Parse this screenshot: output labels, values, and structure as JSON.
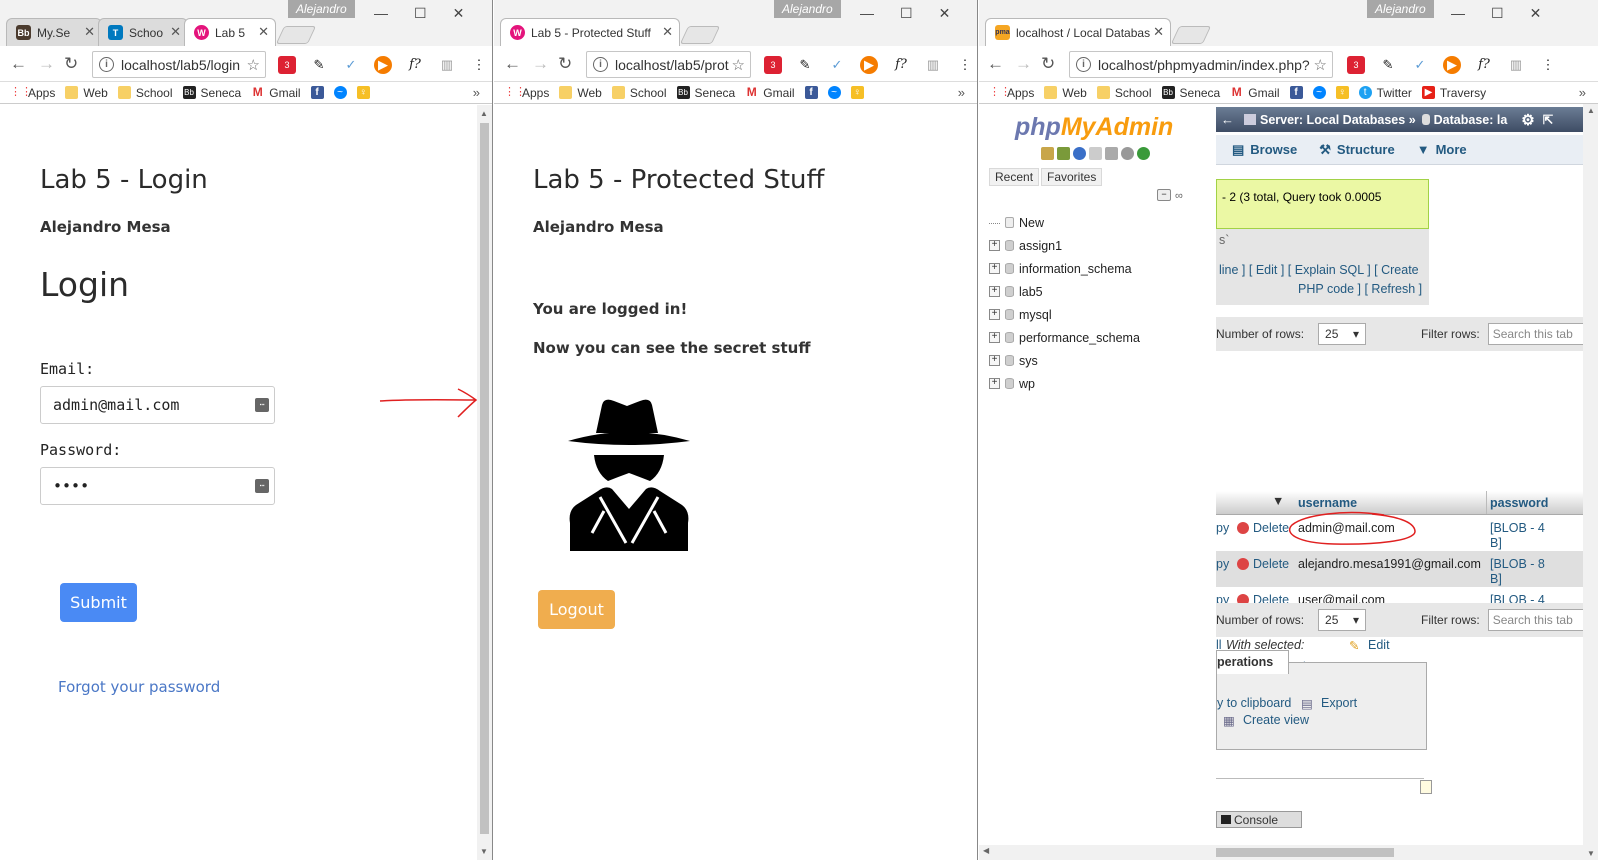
{
  "window1": {
    "user": "Alejandro",
    "tabs": [
      {
        "label": "My.Se",
        "fav": "Bb",
        "color": "#4b3b2e"
      },
      {
        "label": "Schoo",
        "fav": "T",
        "color": "#0079bf"
      },
      {
        "label": "Lab 5",
        "fav": "W",
        "color": "#e4147c"
      }
    ],
    "url": "localhost/lab5/login",
    "bookmarks": [
      "Apps",
      "Web",
      "School",
      "Seneca",
      "Gmail"
    ],
    "page": {
      "title": "Lab 5 - Login",
      "author": "Alejandro Mesa",
      "heading": "Login",
      "email_label": "Email:",
      "email_value": "admin@mail.com",
      "password_label": "Password:",
      "password_value": "••••",
      "submit_label": "Submit",
      "forgot_label": "Forgot your password"
    }
  },
  "window2": {
    "user": "Alejandro",
    "tab_label": "Lab 5 - Protected Stuff",
    "url": "localhost/lab5/prot",
    "bookmarks": [
      "Apps",
      "Web",
      "School",
      "Seneca",
      "Gmail"
    ],
    "page": {
      "title": "Lab 5 - Protected Stuff",
      "author": "Alejandro Mesa",
      "logged_in": "You are logged in!",
      "secret": "Now you can see the secret stuff",
      "logout_label": "Logout"
    }
  },
  "window3": {
    "user": "Alejandro",
    "tab_label": "localhost / Local Databas",
    "url": "localhost/phpmyadmin/index.php?",
    "bookmarks": [
      "Apps",
      "Web",
      "School",
      "Seneca",
      "Gmail",
      "Twitter",
      "Traversy"
    ],
    "pma": {
      "logo_php": "php",
      "logo_my": "MyAdmin",
      "tab_recent": "Recent",
      "tab_favorites": "Favorites",
      "tree": [
        "New",
        "assign1",
        "information_schema",
        "lab5",
        "mysql",
        "performance_schema",
        "sys",
        "wp"
      ],
      "breadcrumb_server": "Server: Local Databases »",
      "breadcrumb_db": "Database: la",
      "menu": [
        "Browse",
        "Structure",
        "More"
      ],
      "query_note": "- 2 (3 total, Query took 0.0005",
      "sql_tail": "s`",
      "sql_links_1": "line ] [ Edit ] [ Explain SQL ] [ Create",
      "sql_links_2": "PHP code ] [ Refresh ]",
      "rows_label": "Number of rows:",
      "rows_value": "25",
      "filter_label": "Filter rows:",
      "search_placeholder": "Search this tab",
      "col_username": "username",
      "col_password": "password",
      "delete_label": "Delete",
      "copy_fragment": "py",
      "rows": [
        {
          "username": "admin@mail.com",
          "p1": "[BLOB - 4",
          "p2": "B]"
        },
        {
          "username": "alejandro.mesa1991@gmail.com",
          "p1": "[BLOB - 8",
          "p2": "B]"
        },
        {
          "username": "user@mail.com",
          "p1": "[BLOB - 4",
          "p2": "B]"
        }
      ],
      "check_all": "ll",
      "with_selected": "With selected:",
      "edit": "Edit",
      "delete_fragment": "ete",
      "export": "Export",
      "operations": "perations",
      "copy_clip": "y to clipboard",
      "create_view": "Create view",
      "console": "Console"
    }
  }
}
